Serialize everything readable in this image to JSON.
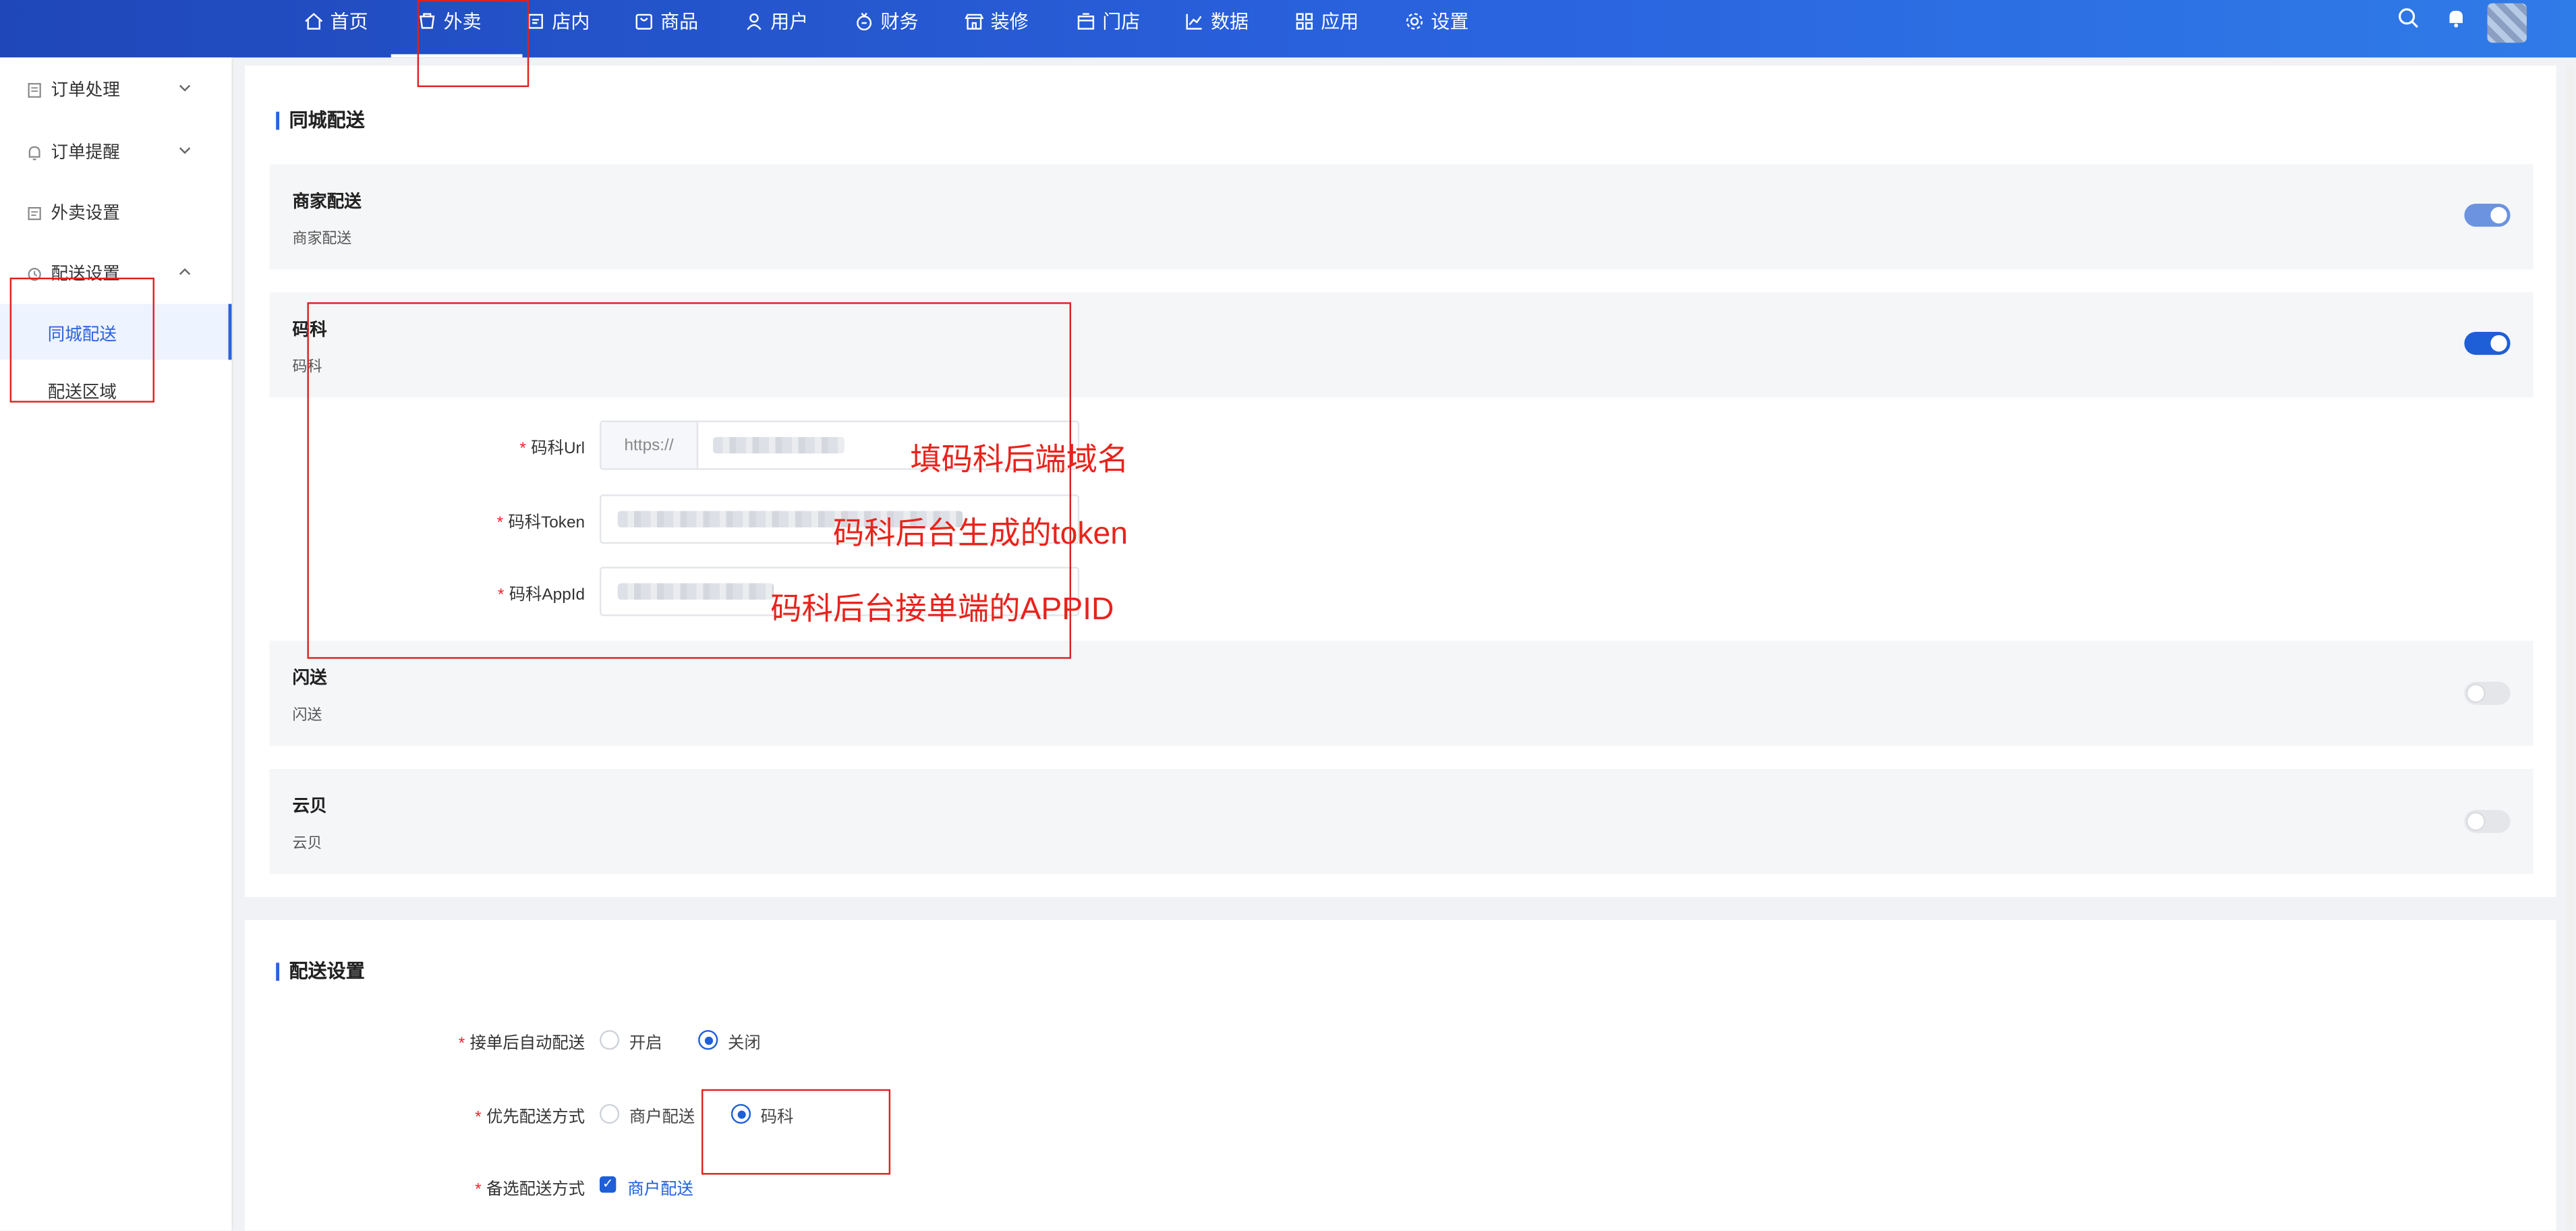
{
  "nav": {
    "items": [
      {
        "label": "首页",
        "icon": "home-icon"
      },
      {
        "label": "外卖",
        "icon": "takeout-icon"
      },
      {
        "label": "店内",
        "icon": "dine-in-icon"
      },
      {
        "label": "商品",
        "icon": "goods-icon"
      },
      {
        "label": "用户",
        "icon": "user-icon"
      },
      {
        "label": "财务",
        "icon": "finance-icon"
      },
      {
        "label": "装修",
        "icon": "decorate-icon"
      },
      {
        "label": "门店",
        "icon": "store-icon"
      },
      {
        "label": "数据",
        "icon": "chart-icon"
      },
      {
        "label": "应用",
        "icon": "apps-icon"
      },
      {
        "label": "设置",
        "icon": "gear-icon"
      }
    ],
    "active": "外卖"
  },
  "sidebar": {
    "groups": [
      {
        "label": "订单处理",
        "icon": "document-icon",
        "expanded": false
      },
      {
        "label": "订单提醒",
        "icon": "bell-icon",
        "expanded": false
      },
      {
        "label": "外卖设置",
        "icon": "takeout-settings-icon"
      },
      {
        "label": "配送设置",
        "icon": "delivery-icon",
        "expanded": true
      }
    ],
    "sub_items": [
      {
        "label": "同城配送",
        "active": true
      },
      {
        "label": "配送区域",
        "active": false
      }
    ]
  },
  "city_delivery": {
    "title": "同城配送",
    "options": [
      {
        "title": "商家配送",
        "desc": "商家配送",
        "enabled": true
      },
      {
        "title": "码科",
        "desc": "码科",
        "enabled": true
      },
      {
        "title": "闪送",
        "desc": "闪送",
        "enabled": false
      },
      {
        "title": "云贝",
        "desc": "云贝",
        "enabled": false
      }
    ],
    "fields": {
      "url_label": "码科Url",
      "url_prefix": "https://",
      "token_label": "码科Token",
      "appid_label": "码科AppId"
    }
  },
  "delivery_settings": {
    "title": "配送设置",
    "auto_label": "接单后自动配送",
    "auto_options": [
      "开启",
      "关闭"
    ],
    "auto_selected": "关闭",
    "priority_label": "优先配送方式",
    "priority_options": [
      "商户配送",
      "码科"
    ],
    "priority_selected": "码科",
    "backup_label": "备选配送方式",
    "backup_option": "商户配送"
  },
  "annotations": [
    "填码科后端域名",
    "码科后台生成的token",
    "码科后台接单端的APPID"
  ],
  "colors": {
    "primary": "#1e5fd8",
    "annotation": "#e8231c"
  }
}
